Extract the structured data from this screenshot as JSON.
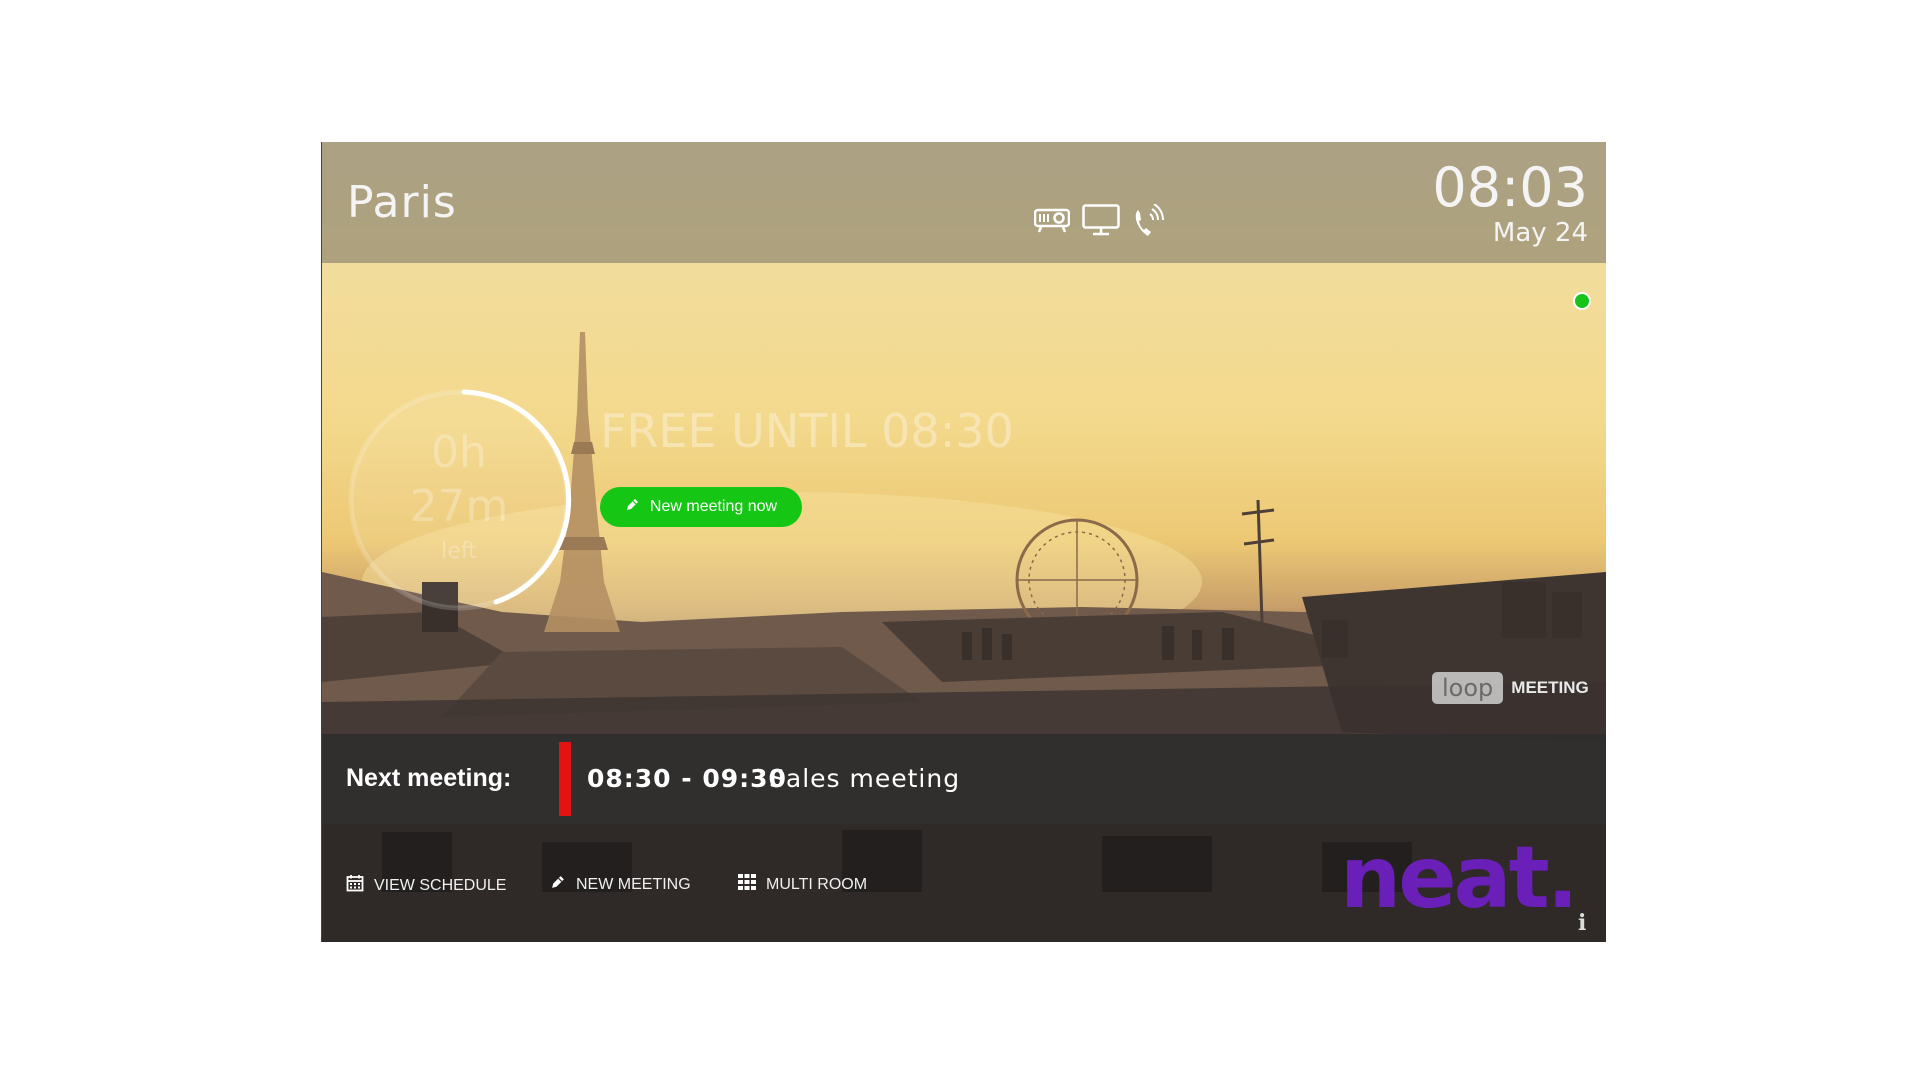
{
  "header": {
    "room_name": "Paris",
    "time": "08:03",
    "date": "May 24",
    "icons": [
      "projector-icon",
      "monitor-icon",
      "phone-icon"
    ]
  },
  "status": {
    "countdown_hours": "0h",
    "countdown_minutes": "27m",
    "countdown_label": "left",
    "headline": "FREE UNTIL 08:30",
    "new_meeting_now_label": "New meeting now"
  },
  "branding": {
    "loop_text": "loop",
    "loop_suffix": "MEETING",
    "vendor_logo_text": "neat."
  },
  "next_meeting": {
    "label": "Next meeting:",
    "time_range": "08:30 - 09:30",
    "title": "Sales meeting"
  },
  "footer": {
    "view_schedule_label": "VIEW SCHEDULE",
    "new_meeting_label": "NEW MEETING",
    "multi_room_label": "MULTI ROOM"
  },
  "colors": {
    "accent_green": "#15c615",
    "next_marker_red": "#e31313",
    "neat_purple": "#6a1fb8",
    "status_dot": "#18c418"
  }
}
